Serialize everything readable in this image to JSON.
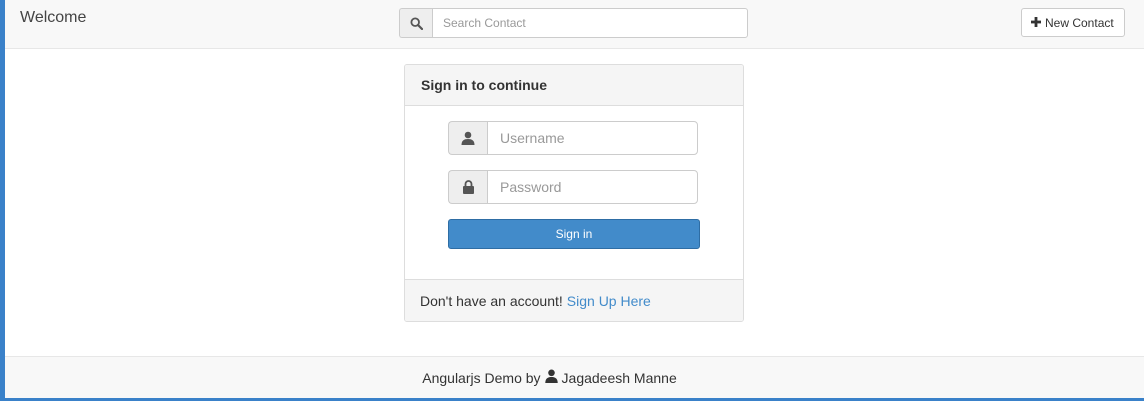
{
  "navbar": {
    "brand": "Welcome",
    "search_icon": "search-icon",
    "search_placeholder": "Search Contact",
    "search_value": "",
    "new_contact_icon": "plus-icon",
    "new_contact_label": "New Contact"
  },
  "login": {
    "heading": "Sign in to continue",
    "username_icon": "user-icon",
    "username_placeholder": "Username",
    "username_value": "",
    "password_icon": "lock-icon",
    "password_placeholder": "Password",
    "password_value": "",
    "submit_label": "Sign in",
    "footer_text": "Don't have an account!",
    "signup_link": "Sign Up Here"
  },
  "footer": {
    "text_prefix": "Angularjs Demo by",
    "author_icon": "user-icon",
    "author": "Jagadeesh Manne"
  },
  "colors": {
    "primary": "#428bca",
    "frame": "#3a81c9",
    "panel_bg": "#f5f5f5",
    "addon_bg": "#eeeeee"
  }
}
